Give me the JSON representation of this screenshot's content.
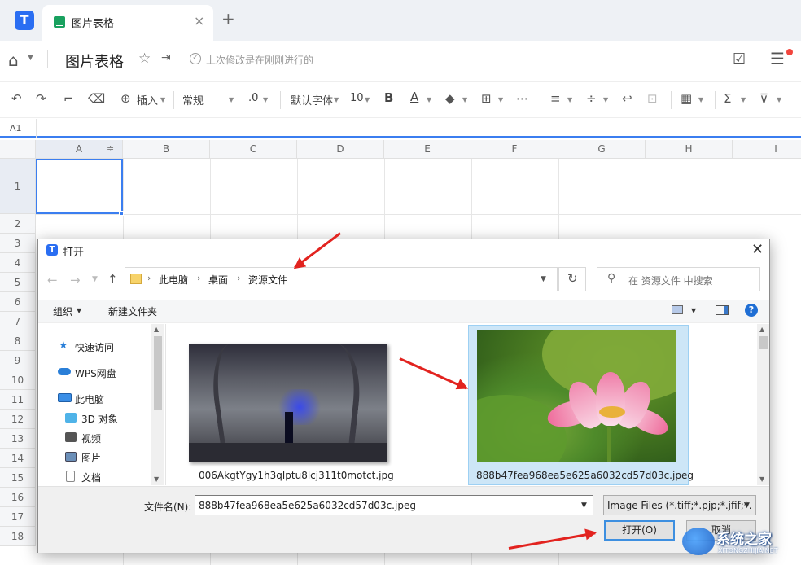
{
  "tab": {
    "title": "图片表格",
    "close": "×",
    "new": "+"
  },
  "header": {
    "doc_title": "图片表格",
    "save_status": "上次修改是在刚刚进行的"
  },
  "toolbar": {
    "insert": "插入",
    "number_format": "常规",
    "decimal": ".0",
    "font": "默认字体",
    "font_size": "10",
    "bold": "B",
    "font_color": "A"
  },
  "formula_bar": {
    "cell_ref": "A1"
  },
  "sheet": {
    "columns": [
      "A",
      "B",
      "C",
      "D",
      "E",
      "F",
      "G",
      "H",
      "I"
    ],
    "rows": [
      "1",
      "2",
      "3",
      "4",
      "5",
      "6",
      "7",
      "8",
      "9",
      "10",
      "11",
      "12",
      "13",
      "14",
      "15",
      "16",
      "17",
      "18"
    ]
  },
  "dialog": {
    "title": "打开",
    "breadcrumb": [
      "此电脑",
      "桌面",
      "资源文件"
    ],
    "search_placeholder": "在 资源文件 中搜索",
    "organize": "组织",
    "new_folder": "新建文件夹",
    "nav_items": [
      {
        "label": "快速访问",
        "icon": "star-icon",
        "color": "#2a7fd8"
      },
      {
        "label": "WPS网盘",
        "icon": "cloud-icon",
        "color": "#2a7fd8"
      },
      {
        "label": "此电脑",
        "icon": "computer-icon",
        "color": "#3a8ee6"
      },
      {
        "label": "3D 对象",
        "icon": "cube-icon",
        "color": "#4fb3e8"
      },
      {
        "label": "视频",
        "icon": "video-icon",
        "color": "#555555"
      },
      {
        "label": "图片",
        "icon": "picture-icon",
        "color": "#6b8fb8"
      },
      {
        "label": "文档",
        "icon": "document-icon",
        "color": "#8a8a8a"
      }
    ],
    "files": [
      {
        "name": "006AkgtYgy1h3qlptu8lcj311t0motct.jpg",
        "selected": false
      },
      {
        "name": "888b47fea968ea5e625a6032cd57d03c.jpeg",
        "selected": true
      }
    ],
    "filename_label": "文件名(N):",
    "filename_value": "888b47fea968ea5e625a6032cd57d03c.jpeg",
    "filetype_value": "Image Files (*.tiff;*.pjp;*.jfif;*.",
    "open_button": "打开(O)",
    "cancel_button": "取消"
  },
  "watermark": {
    "text": "系统之家",
    "sub": "XITONGZHIJIA.NET"
  },
  "colors": {
    "accent": "#3b7ef0",
    "arrow": "#e2231f",
    "selection": "#cde6f7"
  }
}
